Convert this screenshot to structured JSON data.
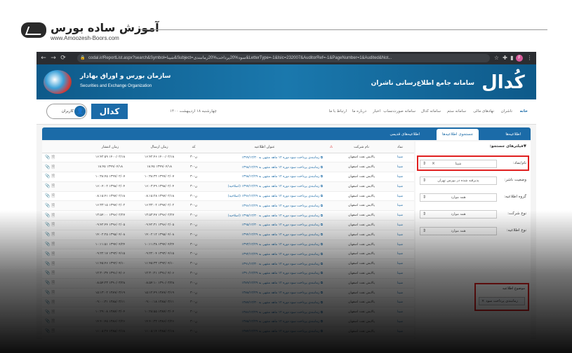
{
  "watermark": {
    "title": "آموزش ساده بورس",
    "url": "www.Amoozesh-Boors.com"
  },
  "browser": {
    "url": "codal.ir/ReportList.aspx?search&Symbol=شپنا&Subject=سود%20پرداخت%20زمانبندی&LetterType=-1&Isic=232007&AuditorRef=-1&PageNumber=1&Audited&Not...",
    "profile_letter": "F"
  },
  "banner": {
    "org_title": "سازمان بورس و اوراق بهادار",
    "org_subtitle": "Securities and Exchange Organization",
    "codal_title": "سامانه جامع اطلاع‌رسانی ناشران",
    "codal_logo": "کُدال"
  },
  "nav": {
    "items": [
      "خانه",
      "ناشران",
      "نهادهای مالی",
      "سامانه ستم",
      "سامانه کدال",
      "سامانه صورت‌نساب",
      "اخبار",
      "درباره ما",
      "ارتباط با ما"
    ],
    "date": "چهارشنبه ۱۸ اردیبهشت ۱۴۰۰",
    "login_label": "ورود کاربران",
    "mini_logo": "کدال"
  },
  "tabs": [
    "اطلاعیه‌ها",
    "جستجوی اطلاعیه‌ها",
    "اطلاعیه‌های قدیمی"
  ],
  "filters": {
    "heading": "▼فیلترهای جستجو:",
    "symbol_label": "نام/نماد:",
    "symbol_value": "شپنا",
    "status_label": "وضعیت ناشر:",
    "status_value": "پذیرفته شده در بورس تهران",
    "group_label": "گروه اطلاعیه:",
    "group_value": "همه موارد",
    "company_type_label": "نوع شرکت:",
    "company_type_value": "همه موارد",
    "letter_type_label": "نوع اطلاعیه:",
    "letter_type_value": "همه موارد",
    "subject_label": "موضوع اطلاعیه",
    "subject_chip": "زمانبندی پرداخت سود"
  },
  "table": {
    "headers": [
      "نماد",
      "نام شرکت",
      "",
      "عنوان اطلاعیه",
      "کد",
      "زمان ارسال",
      "زمان انتشار",
      ""
    ],
    "rows": [
      {
        "symbol": "شپنا",
        "company": "پالایش نفت اصفهان",
        "title": "زمانبندی پرداخت سود دوره ۱۲ ماهه منتهی به ۱۳۹۹/۱۲/۳۰",
        "code": "ن-۳۰",
        "sent": "۱۴۰۰/۰۲/۱۸ ۱۶:۴۲:۴۶",
        "published": "۱۴۰۰/۰۲/۱۸ ۱۶:۴۲:۵۹"
      },
      {
        "symbol": "شپنا",
        "company": "پالایش نفت اصفهان",
        "title": "زمانبندی پرداخت سود دوره ۱۲ ماهه منتهی به ۱۳۹۸/۱۲/۲۹",
        "code": "ن-۳۰",
        "sent": "۱۳۹۹/۰۴/۱۸ ۱۸:۴۵",
        "published": "۱۳۹۹/۰۴/۱۸ ۱۸:۴۵"
      },
      {
        "symbol": "شپنا",
        "company": "پالایش نفت اصفهان",
        "title": "زمانبندی پرداخت سود دوره ۱۲ ماهه منتهی به ۱۳۹۸/۱۲/۲۹",
        "code": "ن-۳۰",
        "sent": "۱۳۹۹/۰۲/۰۷ ۱۰:۳۸:۳۲",
        "published": "۱۳۹۹/۰۲/۰۷ ۱۰:۳۸:۴۵"
      },
      {
        "symbol": "شپنا",
        "company": "پالایش نفت اصفهان",
        "title": "زمانبندی پرداخت سود دوره ۱۲ ماهه منتهی به ۱۳۹۷/۱۲/۲۹ (اصلاحیه)",
        "code": "ن-۳۰",
        "sent": "۱۳۹۸/۰۲/۰۴ ۱۶:۰۳:۴۹",
        "published": "۱۳۹۸/۰۲/۰۴ ۱۶:۰۴:۰۲"
      },
      {
        "symbol": "شپنا",
        "company": "پالایش نفت اصفهان",
        "title": "زمانبندی پرداخت سود دوره ۱۲ ماهه منتهی به ۱۳۹۶/۱۲/۲۹ (اصلاحیه)",
        "code": "ن-۳۰",
        "sent": "۱۳۹۷/۰۲/۱۸ ۰۸:۱۵:۲۸",
        "published": "۱۳۹۷/۰۲/۱۸ ۰۸:۱۵:۴۱"
      },
      {
        "symbol": "شپنا",
        "company": "پالایش نفت اصفهان",
        "title": "زمانبندی پرداخت سود دوره ۱۲ ماهه منتهی به ۱۳۹۶/۱۲/۲۹",
        "code": "ن-۳۰",
        "sent": "۱۳۹۷/۰۲/۰۲ ۱۶:۳۳:۰۲",
        "published": "۱۳۹۷/۰۲/۰۲ ۱۶:۳۳:۱۵"
      },
      {
        "symbol": "شپنا",
        "company": "پالایش نفت اصفهان",
        "title": "زمانبندی پرداخت سود دوره ۱۲ ماهه منتهی به ۱۳۹۵/۱۲/۳۰ (اصلاحیه)",
        "code": "ن-۳۰",
        "sent": "۱۳۹۶/۰۲/۲۷ ۱۳:۵۳:۴۷",
        "published": "۱۳۹۶/۰۲/۲۷ ۱۳:۵۴:۰۰"
      },
      {
        "symbol": "شپنا",
        "company": "پالایش نفت اصفهان",
        "title": "زمانبندی پرداخت سود دوره ۱۲ ماهه منتهی به ۱۳۹۵/۱۲/۳۰",
        "code": "ن-۳۰",
        "sent": "۱۳۹۶/۰۲/۰۵ ۰۹:۴۲:۳۱",
        "published": "۱۳۹۶/۰۲/۰۵ ۰۹:۴۲:۴۴"
      },
      {
        "symbol": "شپنا",
        "company": "پالایش نفت اصفهان",
        "title": "زمانبندی پرداخت سود دوره ۱۲ ماهه منتهی به ۱۳۹۴/۱۲/۲۹",
        "code": "ن-۳۰",
        "sent": "۱۳۹۵/۰۴/۰۸ ۱۴:۰۲:۱۲",
        "published": "۱۳۹۵/۰۴/۰۸ ۱۴:۰۲:۲۵"
      },
      {
        "symbol": "شپنا",
        "company": "پالایش نفت اصفهان",
        "title": "زمانبندی پرداخت سود دوره ۱۲ ماهه منتهی به ۱۳۹۳/۱۲/۲۹",
        "code": "ن-۳۰",
        "sent": "۱۳۹۴/۰۴/۲۴ ۱۰:۱۱:۳۸",
        "published": "۱۳۹۴/۰۴/۲۴ ۱۰:۱۱:۵۱"
      },
      {
        "symbol": "شپنا",
        "company": "پالایش نفت اصفهان",
        "title": "زمانبندی پرداخت سود دوره ۱۲ ماهه منتهی به ۱۳۹۲/۱۲/۲۹",
        "code": "ن-۳۰",
        "sent": "۱۳۹۳/۰۴/۱۵ ۰۹:۲۲:۰۴",
        "published": "۱۳۹۳/۰۴/۱۵ ۰۹:۲۲:۱۷"
      },
      {
        "symbol": "شپنا",
        "company": "پالایش نفت اصفهان",
        "title": "زمانبندی پرداخت سود دوره ۱۲ ماهه منتهی به ۱۳۹۱/۱۲/۳۰",
        "code": "ن-۳۰",
        "sent": "۱۳۹۲/۰۴/۱۰ ۱۱:۴۵:۳۳",
        "published": "۱۳۹۲/۰۴/۱۰ ۱۱:۴۵:۴۶"
      },
      {
        "symbol": "شپنا",
        "company": "پالایش نفت اصفهان",
        "title": "زمانبندی پرداخت سود دوره ۱۲ ماهه منتهی به ۱۳۹۰/۱۲/۲۹",
        "code": "ن-۳۰",
        "sent": "۱۳۹۱/۰۴/۰۶ ۱۲:۳۰:۲۱",
        "published": "۱۳۹۱/۰۴/۰۶ ۱۲:۳۰:۳۴"
      },
      {
        "symbol": "شپنا",
        "company": "پالایش نفت اصفهان",
        "title": "زمانبندی پرداخت سود دوره ۱۲ ماهه منتهی به ۱۳۸۹/۱۲/۲۹",
        "code": "ن-۳۰",
        "sent": "۱۳۹۰/۰۳/۲۸ ۰۸:۵۴:۱۰",
        "published": "۱۳۹۰/۰۳/۲۸ ۰۸:۵۴:۲۳"
      },
      {
        "symbol": "شپنا",
        "company": "پالایش نفت اصفهان",
        "title": "زمانبندی پرداخت سود دوره ۱۲ ماهه منتهی به ۱۳۸۸/۱۲/۲۹",
        "code": "ن-۳۰",
        "sent": "۱۳۸۹/۰۳/۱۹ ۱۵:۱۲:۴۹",
        "published": "۱۳۸۹/۰۳/۱۹ ۱۵:۱۳:۰۲"
      },
      {
        "symbol": "شپنا",
        "company": "پالایش نفت اصفهان",
        "title": "زمانبندی پرداخت سود دوره ۱۲ ماهه منتهی به ۱۳۸۷/۱۲/۳۰",
        "code": "ن-۳۰",
        "sent": "۱۳۸۸/۰۳/۱۱ ۰۹:۰۰:۱۸",
        "published": "۱۳۸۸/۰۳/۱۱ ۰۹:۰۰:۳۱"
      },
      {
        "symbol": "شپنا",
        "company": "پالایش نفت اصفهان",
        "title": "زمانبندی پرداخت سود دوره ۱۲ ماهه منتهی به ۱۳۸۶/۱۲/۲۹",
        "code": "ن-۳۰",
        "sent": "۱۳۸۷/۰۳/۰۴ ۱۰:۲۸:۵۵",
        "published": "۱۳۸۷/۰۳/۰۴ ۱۰:۲۹:۰۸"
      },
      {
        "symbol": "شپنا",
        "company": "پالایش نفت اصفهان",
        "title": "زمانبندی پرداخت سود دوره ۱۲ ماهه منتهی به ۱۳۸۵/۱۲/۲۹",
        "code": "ن-۳۰",
        "sent": "۱۳۸۶/۰۲/۲۶ ۱۴:۴۰:۳۲",
        "published": "۱۳۸۶/۰۲/۲۶ ۱۴:۴۰:۴۵"
      },
      {
        "symbol": "شپنا",
        "company": "پالایش نفت اصفهان",
        "title": "زمانبندی پرداخت سود دوره ۱۲ ماهه منتهی به ۱۳۸۴/۱۲/۲۹",
        "code": "ن-۳۰",
        "sent": "۱۳۸۵/۰۲/۱۸ ۱۱:۰۵:۱۴",
        "published": "۱۳۸۵/۰۲/۱۸ ۱۱:۰۵:۲۷"
      }
    ]
  }
}
